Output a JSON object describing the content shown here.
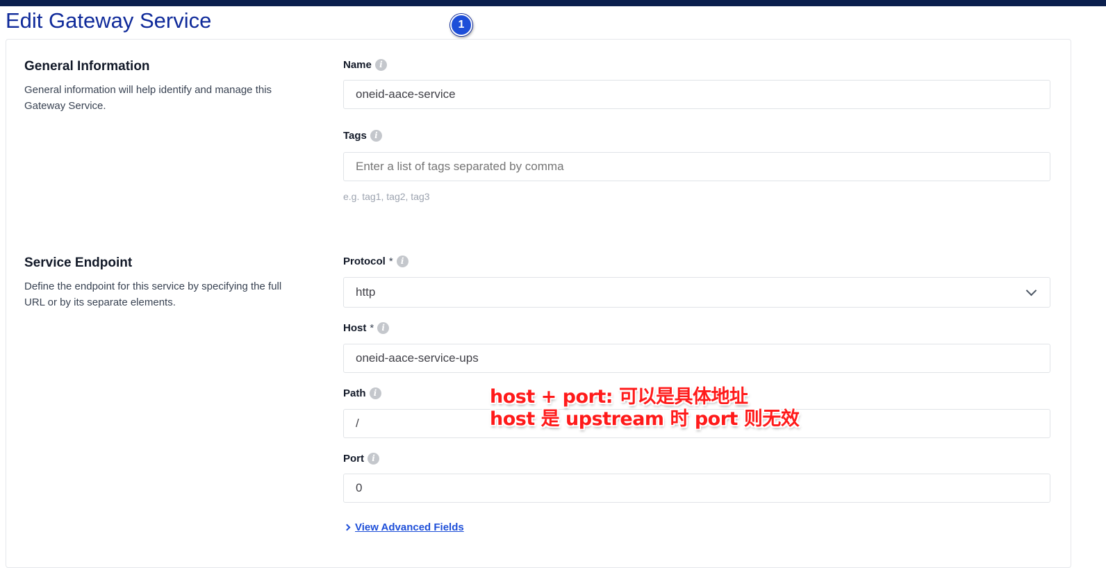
{
  "page": {
    "title": "Edit Gateway Service",
    "step_badge": "1"
  },
  "general": {
    "title": "General Information",
    "description": "General information will help identify and manage this Gateway Service.",
    "name_label": "Name",
    "name_value": "oneid-aace-service",
    "tags_label": "Tags",
    "tags_placeholder": "Enter a list of tags separated by comma",
    "tags_hint": "e.g. tag1, tag2, tag3"
  },
  "endpoint": {
    "title": "Service Endpoint",
    "description": "Define the endpoint for this service by specifying the full URL or by its separate elements.",
    "protocol_label": "Protocol",
    "protocol_value": "http",
    "host_label": "Host",
    "host_value": "oneid-aace-service-ups",
    "path_label": "Path",
    "path_value": "/",
    "port_label": "Port",
    "port_value": "0",
    "required_mark": "*",
    "advanced_link": "View Advanced Fields"
  },
  "annotation": {
    "line1": "host + port: 可以是具体地址",
    "line2": "host 是 upstream 时 port 则无效",
    "color": "#ff1a1a"
  },
  "colors": {
    "title": "#0f2a9a",
    "topbar": "#0b1f4d",
    "link": "#1d4ed8"
  }
}
